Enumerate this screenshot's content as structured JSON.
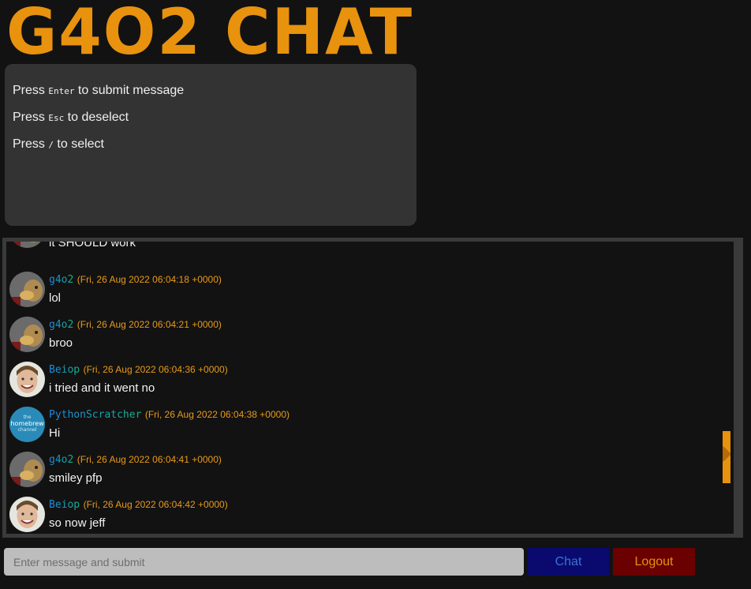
{
  "app": {
    "title": "G4O2 CHAT"
  },
  "help": {
    "lines": [
      {
        "pre": "Press ",
        "key": "Enter",
        "post": " to submit message"
      },
      {
        "pre": "Press ",
        "key": "Esc",
        "post": " to deselect"
      },
      {
        "pre": "Press ",
        "key": "/",
        "post": " to select"
      }
    ]
  },
  "messages": [
    {
      "username": "",
      "timestamp": "",
      "text": "it SHOULD work",
      "avatar": "duck-avatar"
    },
    {
      "username": "g4o2",
      "timestamp": "(Fri, 26 Aug 2022 06:04:18 +0000)",
      "text": "lol",
      "avatar": "duck-avatar"
    },
    {
      "username": "g4o2",
      "timestamp": "(Fri, 26 Aug 2022 06:04:21 +0000)",
      "text": "broo",
      "avatar": "duck-avatar"
    },
    {
      "username": "Beiop",
      "timestamp": "(Fri, 26 Aug 2022 06:04:36 +0000)",
      "text": "i tried and it went no",
      "avatar": "smiling-man-avatar"
    },
    {
      "username": "PythonScratcher",
      "timestamp": "(Fri, 26 Aug 2022 06:04:38 +0000)",
      "text": "Hi",
      "avatar": "homebrew-channel-avatar"
    },
    {
      "username": "g4o2",
      "timestamp": "(Fri, 26 Aug 2022 06:04:41 +0000)",
      "text": "smiley pfp",
      "avatar": "duck-avatar"
    },
    {
      "username": "Beiop",
      "timestamp": "(Fri, 26 Aug 2022 06:04:42 +0000)",
      "text": "so now jeff",
      "avatar": "smiling-man-avatar"
    }
  ],
  "homebrew_avatar_text": [
    "the",
    "homebrew",
    "channel"
  ],
  "composer": {
    "placeholder": "Enter message and submit",
    "value": ""
  },
  "buttons": {
    "chat": "Chat",
    "logout": "Logout"
  },
  "colors": {
    "accent_orange": "#e8920e",
    "chat_button_bg": "#0a0a6e",
    "logout_button_bg": "#6a0000",
    "background": "#121212",
    "panel": "#333333"
  }
}
